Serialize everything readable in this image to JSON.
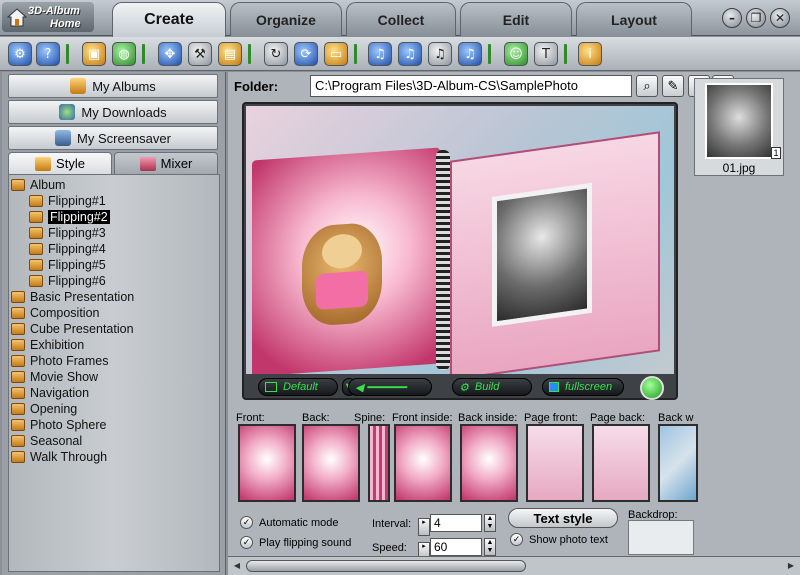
{
  "app": {
    "logo_line1": "3D-Album",
    "logo_line2": "Home"
  },
  "tabs": [
    {
      "label": "Create",
      "active": true
    },
    {
      "label": "Organize",
      "active": false
    },
    {
      "label": "Collect",
      "active": false
    },
    {
      "label": "Edit",
      "active": false
    },
    {
      "label": "Layout",
      "active": false
    }
  ],
  "window_buttons": {
    "minimize": "–",
    "restore": "❐",
    "close": "✕"
  },
  "toolbar_icons": [
    "settings-icon",
    "help-icon",
    "album-icon",
    "globe-icon",
    "fit-icon",
    "tools-icon",
    "photo-icon",
    "rotate-icon",
    "refresh-icon",
    "folder-icon",
    "music-icon",
    "music-edit-icon",
    "music-play-icon",
    "music-mute-icon",
    "user-icon",
    "text-icon",
    "info-icon"
  ],
  "left_panel": {
    "buttons": [
      "My Albums",
      "My Downloads",
      "My Screensaver"
    ],
    "tabs": [
      {
        "label": "Style",
        "active": true
      },
      {
        "label": "Mixer",
        "active": false
      }
    ],
    "tree": [
      {
        "label": "Album",
        "level": 0,
        "selected": false
      },
      {
        "label": "Flipping#1",
        "level": 1,
        "selected": false
      },
      {
        "label": "Flipping#2",
        "level": 1,
        "selected": true
      },
      {
        "label": "Flipping#3",
        "level": 1,
        "selected": false
      },
      {
        "label": "Flipping#4",
        "level": 1,
        "selected": false
      },
      {
        "label": "Flipping#5",
        "level": 1,
        "selected": false
      },
      {
        "label": "Flipping#6",
        "level": 1,
        "selected": false
      },
      {
        "label": "Basic Presentation",
        "level": 0,
        "selected": false
      },
      {
        "label": "Composition",
        "level": 0,
        "selected": false
      },
      {
        "label": "Cube Presentation",
        "level": 0,
        "selected": false
      },
      {
        "label": "Exhibition",
        "level": 0,
        "selected": false
      },
      {
        "label": "Photo Frames",
        "level": 0,
        "selected": false
      },
      {
        "label": "Movie Show",
        "level": 0,
        "selected": false
      },
      {
        "label": "Navigation",
        "level": 0,
        "selected": false
      },
      {
        "label": "Opening",
        "level": 0,
        "selected": false
      },
      {
        "label": "Photo Sphere",
        "level": 0,
        "selected": false
      },
      {
        "label": "Seasonal",
        "level": 0,
        "selected": false
      },
      {
        "label": "Walk Through",
        "level": 0,
        "selected": false
      }
    ]
  },
  "folder": {
    "label": "Folder:",
    "path": "C:\\Program Files\\3D-Album-CS\\SamplePhoto"
  },
  "folder_icons": [
    "search-icon",
    "pencil-icon",
    "palette-icon",
    "heart-icon"
  ],
  "preview_controls": {
    "default_label": "Default",
    "build_label": "Build",
    "fullscreen_label": "fullscreen"
  },
  "thumbnail": {
    "name": "01.jpg",
    "count": "1"
  },
  "covers": [
    "Front:",
    "Back:",
    "Spine:",
    "Front inside:",
    "Back inside:",
    "Page front:",
    "Page back:",
    "Back w"
  ],
  "options": {
    "automatic_mode": "Automatic mode",
    "play_sound": "Play flipping sound",
    "interval_label": "Interval:",
    "interval_value": "4",
    "speed_label": "Speed:",
    "speed_value": "60",
    "text_style": "Text style",
    "show_photo_text": "Show photo text",
    "backdrop": "Backdrop:"
  }
}
